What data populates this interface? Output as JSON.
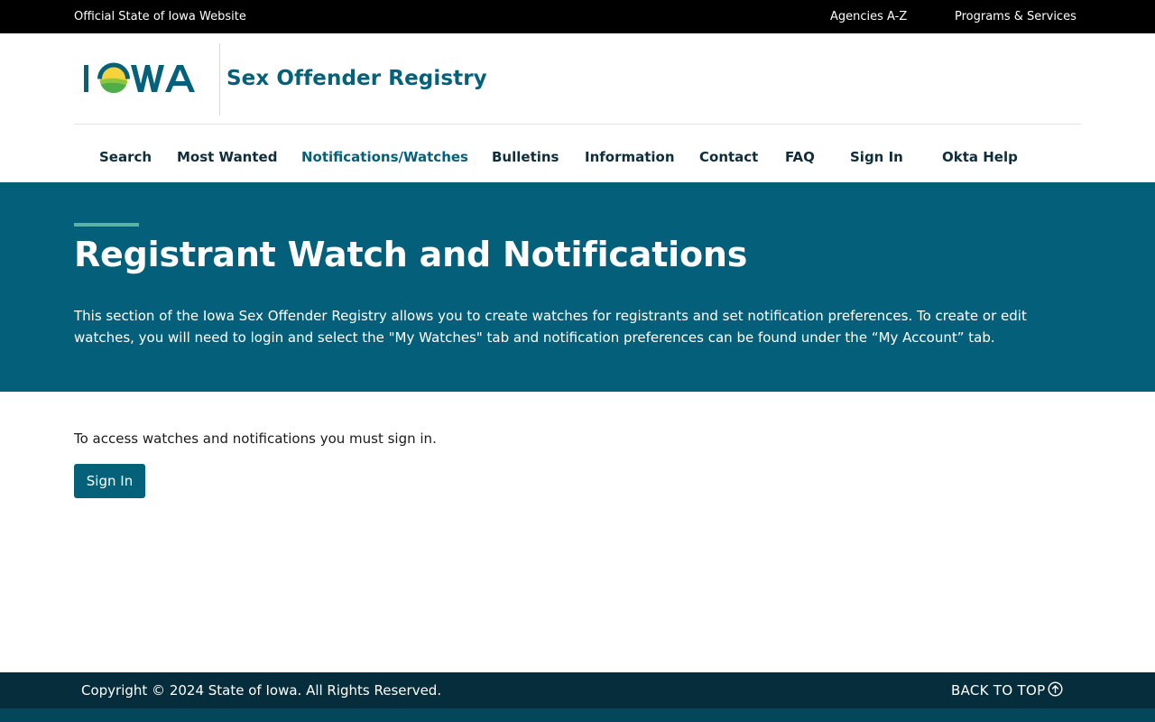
{
  "utility": {
    "official": "Official State of Iowa Website",
    "agencies": "Agencies A-Z",
    "programs": "Programs & Services"
  },
  "header": {
    "logo_text": "IOWA",
    "site_title": "Sex Offender Registry"
  },
  "nav": {
    "items": [
      {
        "label": "Search"
      },
      {
        "label": "Most Wanted"
      },
      {
        "label": "Notifications/Watches",
        "active": true
      },
      {
        "label": "Bulletins"
      },
      {
        "label": "Information"
      },
      {
        "label": "Contact"
      },
      {
        "label": "FAQ"
      },
      {
        "label": "Sign In"
      },
      {
        "label": "Okta Help"
      }
    ]
  },
  "hero": {
    "title": "Registrant Watch and Notifications",
    "description": "This section of the Iowa Sex Offender Registry allows you to create watches for registrants and set notification preferences. To create or edit watches, you will need to login and select the \"My Watches\" tab and notification preferences can be found under the “My Account” tab."
  },
  "main": {
    "message": "To access watches and notifications you must sign in.",
    "signin_label": "Sign In"
  },
  "footer": {
    "copyright": "Copyright © 2024 State of Iowa. All Rights Reserved.",
    "back_to_top": "BACK TO TOP"
  },
  "colors": {
    "brand": "#05617a",
    "hero_bg": "#04607a",
    "accent": "#5bb3a4",
    "footer_bg": "#062d3c",
    "logo_sun": "#f2c200"
  },
  "icons": {
    "back_to_top": "arrow-up-circle-icon"
  }
}
